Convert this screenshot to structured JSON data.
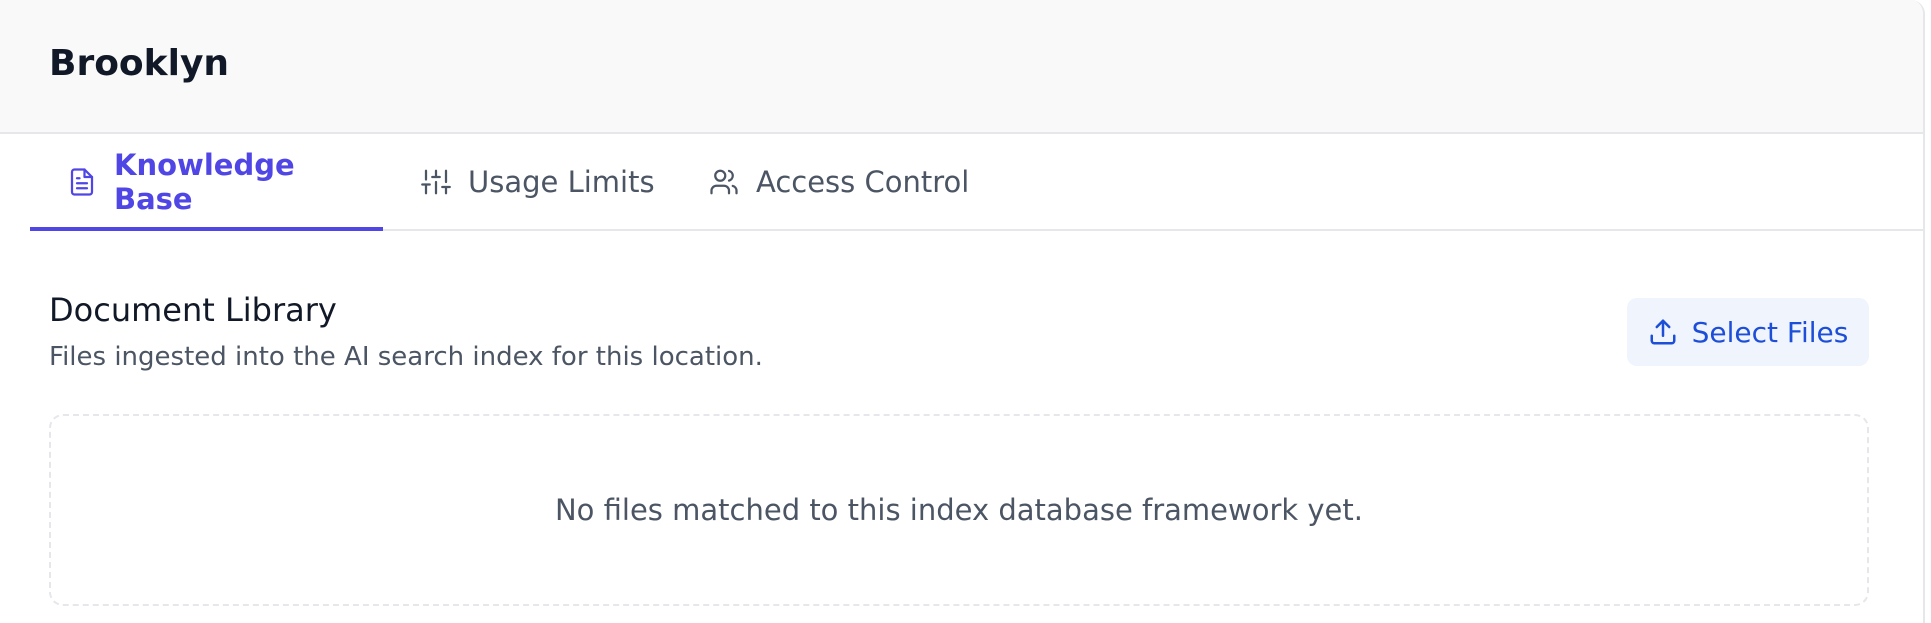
{
  "header": {
    "title": "Brooklyn"
  },
  "tabs": [
    {
      "label": "Knowledge Base",
      "icon": "document-icon",
      "active": true
    },
    {
      "label": "Usage Limits",
      "icon": "sliders-icon",
      "active": false
    },
    {
      "label": "Access Control",
      "icon": "users-icon",
      "active": false
    }
  ],
  "library": {
    "title": "Document Library",
    "subtitle": "Files ingested into the AI search index for this location.",
    "select_button_label": "Select Files",
    "select_button_icon": "upload-icon",
    "empty_message": "No files matched to this index database framework yet."
  },
  "colors": {
    "accent": "#4f46e5",
    "button_text": "#1d4ed8",
    "button_bg": "#eff4fd",
    "header_bg": "#f9f9f9",
    "border": "#e5e7eb"
  }
}
